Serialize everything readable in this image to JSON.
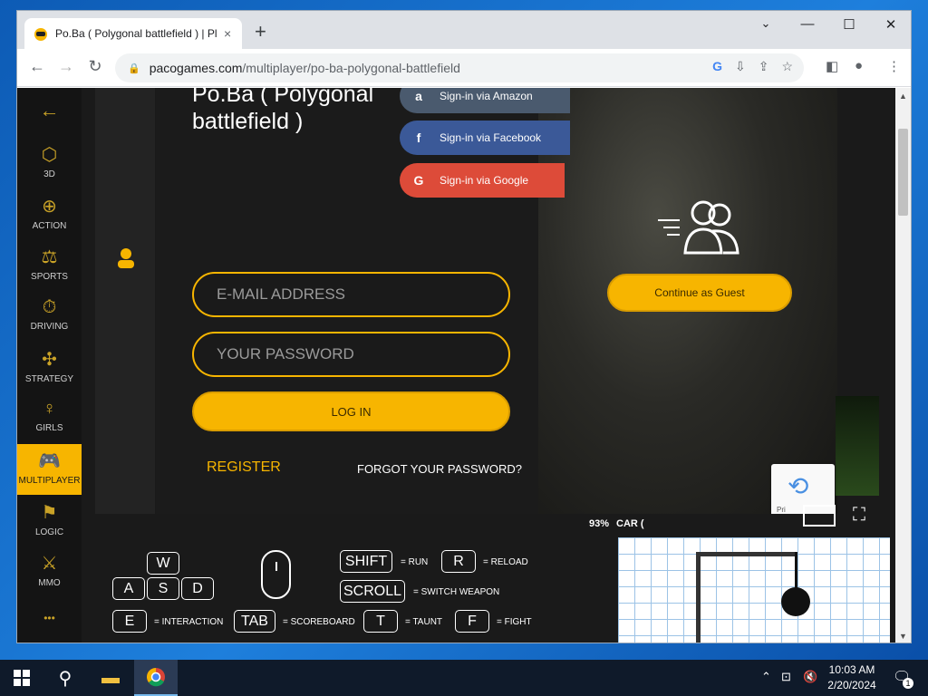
{
  "browser": {
    "tab_title": "Po.Ba ( Polygonal battlefield ) | Pl",
    "tab_close": "×",
    "new_tab": "+",
    "url_domain": "pacogames.com",
    "url_path": "/multiplayer/po-ba-polygonal-battlefield",
    "win_minimize": "—",
    "win_maximize": "☐",
    "win_close": "✕",
    "tab_list": "⌄"
  },
  "sidebar": {
    "back_icon": "←",
    "items": [
      {
        "label": "3D",
        "icon": "cube-icon",
        "glyph": "⬡"
      },
      {
        "label": "ACTION",
        "icon": "crosshair-icon",
        "glyph": "⊕"
      },
      {
        "label": "SPORTS",
        "icon": "dumbbell-icon",
        "glyph": "⚖"
      },
      {
        "label": "DRIVING",
        "icon": "stopwatch-icon",
        "glyph": "⏱"
      },
      {
        "label": "STRATEGY",
        "icon": "strategy-icon",
        "glyph": "✣"
      },
      {
        "label": "GIRLS",
        "icon": "girl-icon",
        "glyph": "♀"
      },
      {
        "label": "MULTIPLAYER",
        "icon": "gamepad-icon",
        "glyph": "🎮",
        "active": true
      },
      {
        "label": "LOGIC",
        "icon": "logic-icon",
        "glyph": "⚑"
      },
      {
        "label": "MMO",
        "icon": "swords-icon",
        "glyph": "⚔"
      }
    ],
    "more": "•••"
  },
  "login": {
    "game_title": "Po.Ba ( Polygonal battlefield )",
    "email_placeholder": "E-MAIL ADDRESS",
    "password_placeholder": "YOUR PASSWORD",
    "login_button": "LOG IN",
    "register": "REGISTER",
    "forgot": "FORGOT YOUR PASSWORD?",
    "social": [
      {
        "label": "Sign-in via Amazon",
        "glyph": "a",
        "color": "#4a5a6e"
      },
      {
        "label": "Sign-in via Facebook",
        "glyph": "f",
        "color": "#3b5998"
      },
      {
        "label": "Sign-in via Google",
        "glyph": "G",
        "color": "#dd4b39"
      }
    ],
    "guest_button": "Continue as Guest"
  },
  "game": {
    "zoom": "93%",
    "car_text": "CAR (",
    "recaptcha_label": "Pri",
    "fullscreen_glyph": "⛶"
  },
  "keys": {
    "w": "W",
    "a": "A",
    "s": "S",
    "d": "D",
    "shift": "SHIFT",
    "shift_label": "= RUN",
    "r": "R",
    "r_label": "= RELOAD",
    "scroll": "SCROLL",
    "scroll_label": "= SWITCH WEAPON",
    "e": "E",
    "e_label": "= INTERACTION",
    "tab": "TAB",
    "tab_label": "= SCOREBOARD",
    "t": "T",
    "t_label": "= TAUNT",
    "f": "F",
    "f_label": "= FIGHT"
  },
  "taskbar": {
    "time": "10:03 AM",
    "date": "2/20/2024",
    "notif_count": "1"
  }
}
